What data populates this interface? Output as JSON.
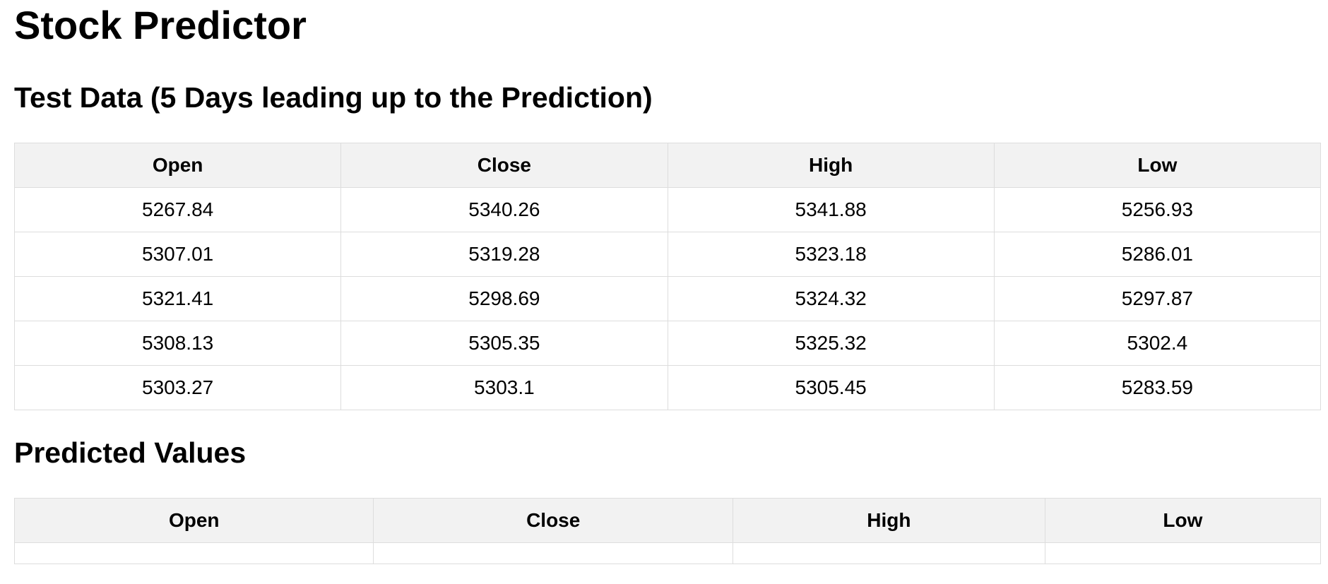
{
  "page": {
    "title": "Stock Predictor"
  },
  "test_section": {
    "heading": "Test Data (5 Days leading up to the Prediction)",
    "columns": [
      "Open",
      "Close",
      "High",
      "Low"
    ],
    "rows": [
      [
        "5267.84",
        "5340.26",
        "5341.88",
        "5256.93"
      ],
      [
        "5307.01",
        "5319.28",
        "5323.18",
        "5286.01"
      ],
      [
        "5321.41",
        "5298.69",
        "5324.32",
        "5297.87"
      ],
      [
        "5308.13",
        "5305.35",
        "5325.32",
        "5302.4"
      ],
      [
        "5303.27",
        "5303.1",
        "5305.45",
        "5283.59"
      ]
    ]
  },
  "predicted_section": {
    "heading": "Predicted Values",
    "columns": [
      "Open",
      "Close",
      "High",
      "Low"
    ],
    "rows": [
      [
        "",
        "",
        "",
        ""
      ]
    ]
  }
}
